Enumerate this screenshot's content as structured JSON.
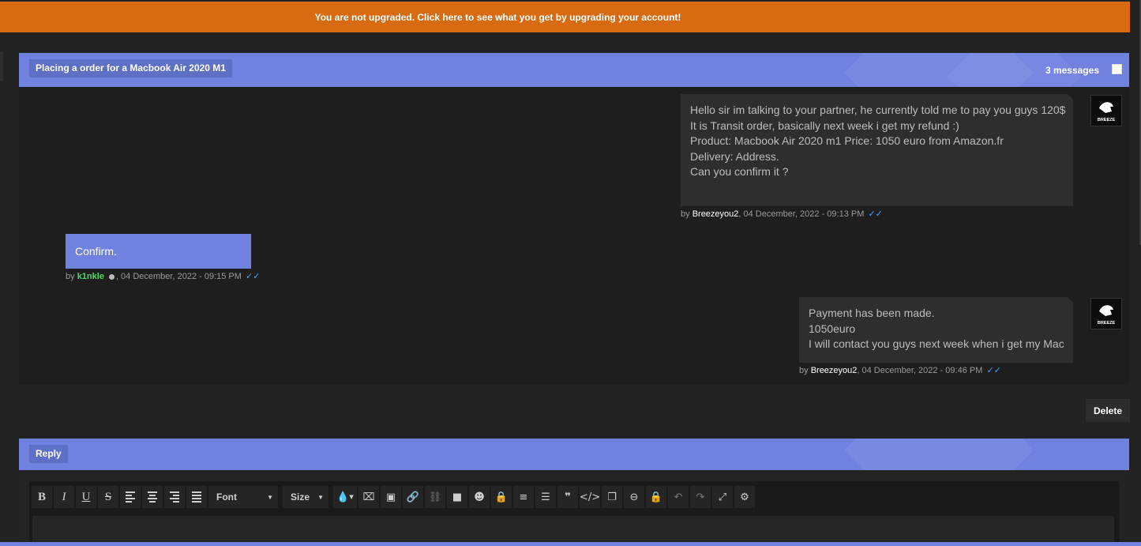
{
  "banner": {
    "text": "You are not upgraded. Click here to see what you get by upgrading your account!"
  },
  "thread": {
    "title": "Placing a order for a Macbook Air 2020 M1",
    "count_label": "3 messages",
    "messages": [
      {
        "direction": "in",
        "lines": [
          "Hello sir im talking to your partner, he currently told me to pay you guys 120$",
          "It is Transit order, basically next week i get my refund :)",
          "Product: Macbook Air 2020 m1 Price: 1050 euro from Amazon.fr",
          "Delivery: Address.",
          "Can you confirm it ?"
        ],
        "by": "by ",
        "user": "Breezeyou2",
        "date": ", 04 December, 2022 - 09:13 PM",
        "avatar_text": "BREEZE"
      },
      {
        "direction": "out",
        "lines": [
          "Confirm."
        ],
        "by": "by ",
        "user": "k1nkle",
        "date": ", 04 December, 2022 - 09:15 PM"
      },
      {
        "direction": "in",
        "lines": [
          "Payment has been made.",
          "1050euro",
          "I will contact you guys next week when i get my Mac"
        ],
        "by": "by ",
        "user": "Breezeyou2",
        "date": ", 04 December, 2022 - 09:46 PM",
        "avatar_text": "BREEZE"
      }
    ],
    "read_ticks": "✓✓"
  },
  "actions": {
    "delete_label": "Delete"
  },
  "reply": {
    "title": "Reply",
    "toolbar": {
      "font_label": "Font",
      "size_label": "Size",
      "icons": [
        "bold-icon",
        "italic-icon",
        "underline-icon",
        "strikethrough-icon",
        "align-left-icon",
        "align-center-icon",
        "align-right-icon",
        "justify-icon"
      ]
    }
  },
  "colors": {
    "banner": "#d86a12",
    "accent": "#7181e0",
    "background": "#222222",
    "online_user": "#4cd964",
    "tick": "#4ea1f3"
  }
}
